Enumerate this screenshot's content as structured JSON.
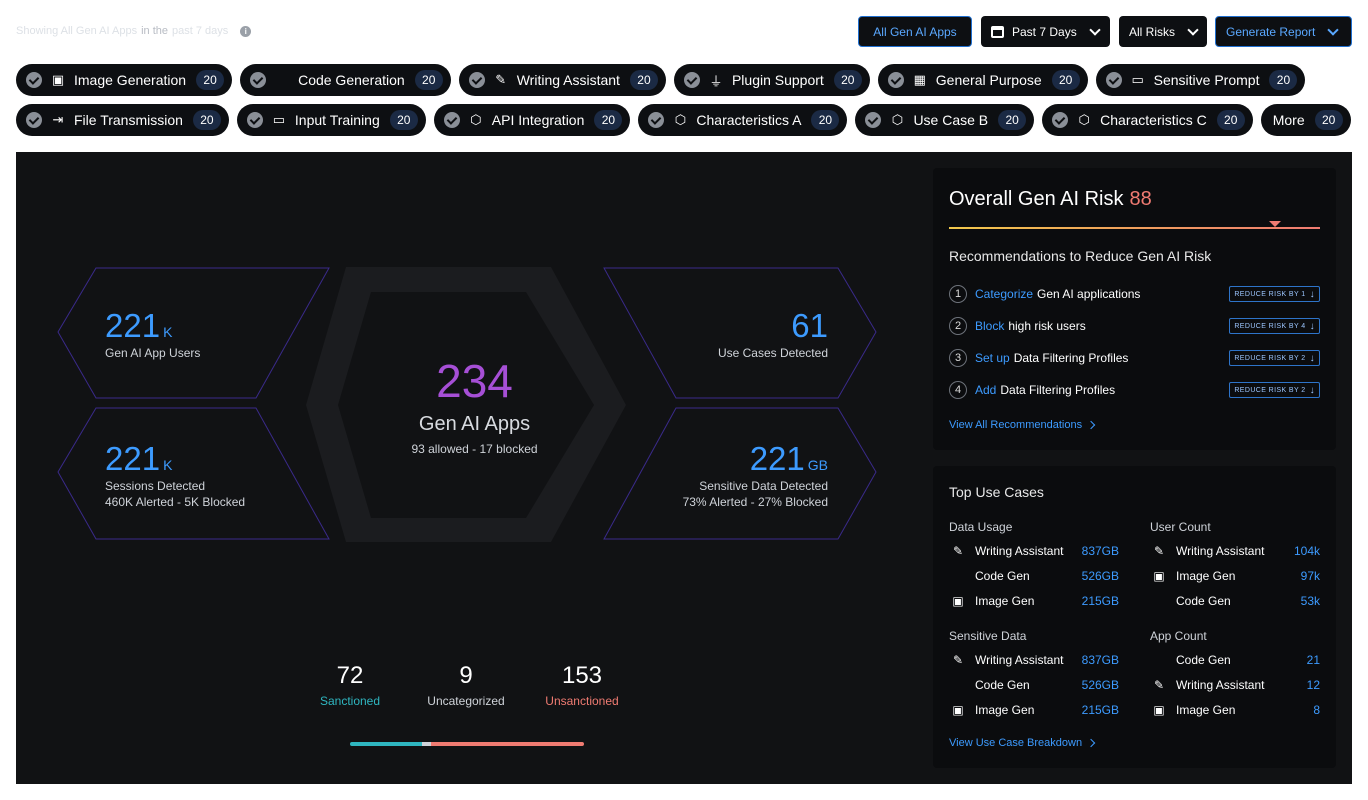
{
  "topline": {
    "showing": "Showing All Gen AI Apps",
    "in_the": "in the",
    "period": "past 7 days"
  },
  "controls": {
    "all_apps": "All Gen AI Apps",
    "period": "Past 7 Days",
    "risks": "All Risks",
    "report": "Generate Report"
  },
  "chips_row1": [
    {
      "label": "Image Generation",
      "count": "20",
      "icon": "image-icon"
    },
    {
      "label": "Code Generation",
      "count": "20",
      "icon": "code-icon"
    },
    {
      "label": "Writing Assistant",
      "count": "20",
      "icon": "pen-icon"
    },
    {
      "label": "Plugin Support",
      "count": "20",
      "icon": "plug-icon"
    },
    {
      "label": "General Purpose",
      "count": "20",
      "icon": "chip-icon"
    },
    {
      "label": "Sensitive Prompt",
      "count": "20",
      "icon": "chat-icon"
    }
  ],
  "chips_row2": [
    {
      "label": "File Transmission",
      "count": "20",
      "icon": "file-export-icon"
    },
    {
      "label": "Input Training",
      "count": "20",
      "icon": "input-icon"
    },
    {
      "label": "API Integration",
      "count": "20",
      "icon": "api-icon"
    },
    {
      "label": "Characteristics A",
      "count": "20",
      "icon": "api-icon"
    },
    {
      "label": "Use Case B",
      "count": "20",
      "icon": "api-icon"
    },
    {
      "label": "Characteristics C",
      "count": "20",
      "icon": "api-icon"
    }
  ],
  "chip_more": {
    "label": "More",
    "count": "20"
  },
  "stats": {
    "users": {
      "value": "221",
      "unit": "K",
      "label": "Gen AI App Users"
    },
    "sessions": {
      "value": "221",
      "unit": "K",
      "label": "Sessions Detected",
      "sub": "460K Alerted - 5K Blocked"
    },
    "usecases": {
      "value": "61",
      "label": "Use Cases Detected"
    },
    "sensitive": {
      "value": "221",
      "unit": "GB",
      "label": "Sensitive Data Detected",
      "sub": "73% Alerted - 27% Blocked"
    },
    "apps": {
      "value": "234",
      "label": "Gen AI Apps",
      "sub": "93 allowed - 17 blocked"
    }
  },
  "legend": {
    "sanctioned": {
      "value": "72",
      "label": "Sanctioned"
    },
    "uncategorized": {
      "value": "9",
      "label": "Uncategorized"
    },
    "unsanctioned": {
      "value": "153",
      "label": "Unsanctioned"
    }
  },
  "colors": {
    "sanctioned": "#2fb6c0",
    "uncategorized": "#cfd3d9",
    "unsanctioned": "#f07b72",
    "accent": "#3d9bff",
    "apps": "#a64fd6"
  },
  "risk": {
    "title": "Overall Gen AI Risk",
    "score": "88",
    "score_fraction": 0.88,
    "rec_title": "Recommendations to Reduce Gen AI Risk",
    "recs": [
      {
        "n": "1",
        "link": "Categorize",
        "text": "Gen AI applications",
        "btn": "REDUCE RISK BY 1"
      },
      {
        "n": "2",
        "link": "Block",
        "text": "high risk users",
        "btn": "REDUCE RISK BY 4"
      },
      {
        "n": "3",
        "link": "Set up",
        "text": "Data Filtering Profiles",
        "btn": "REDUCE RISK BY 2"
      },
      {
        "n": "4",
        "link": "Add",
        "text": "Data Filtering Profiles",
        "btn": "REDUCE RISK BY 2"
      }
    ],
    "view_all": "View All Recommendations"
  },
  "usecases": {
    "title": "Top Use Cases",
    "data_usage": {
      "title": "Data Usage",
      "rows": [
        {
          "icon": "pen-icon",
          "label": "Writing Assistant",
          "value": "837GB"
        },
        {
          "icon": "code-icon",
          "label": "Code Gen",
          "value": "526GB"
        },
        {
          "icon": "image-icon",
          "label": "Image Gen",
          "value": "215GB"
        }
      ]
    },
    "user_count": {
      "title": "User Count",
      "rows": [
        {
          "icon": "pen-icon",
          "label": "Writing Assistant",
          "value": "104k"
        },
        {
          "icon": "image-icon",
          "label": "Image Gen",
          "value": "97k"
        },
        {
          "icon": "code-icon",
          "label": "Code Gen",
          "value": "53k"
        }
      ]
    },
    "sensitive_data": {
      "title": "Sensitive Data",
      "rows": [
        {
          "icon": "pen-icon",
          "label": "Writing Assistant",
          "value": "837GB"
        },
        {
          "icon": "code-icon",
          "label": "Code Gen",
          "value": "526GB"
        },
        {
          "icon": "image-icon",
          "label": "Image Gen",
          "value": "215GB"
        }
      ]
    },
    "app_count": {
      "title": "App Count",
      "rows": [
        {
          "icon": "code-icon",
          "label": "Code Gen",
          "value": "21"
        },
        {
          "icon": "pen-icon",
          "label": "Writing Assistant",
          "value": "12"
        },
        {
          "icon": "image-icon",
          "label": "Image Gen",
          "value": "8"
        }
      ]
    },
    "view_breakdown": "View Use Case Breakdown"
  }
}
